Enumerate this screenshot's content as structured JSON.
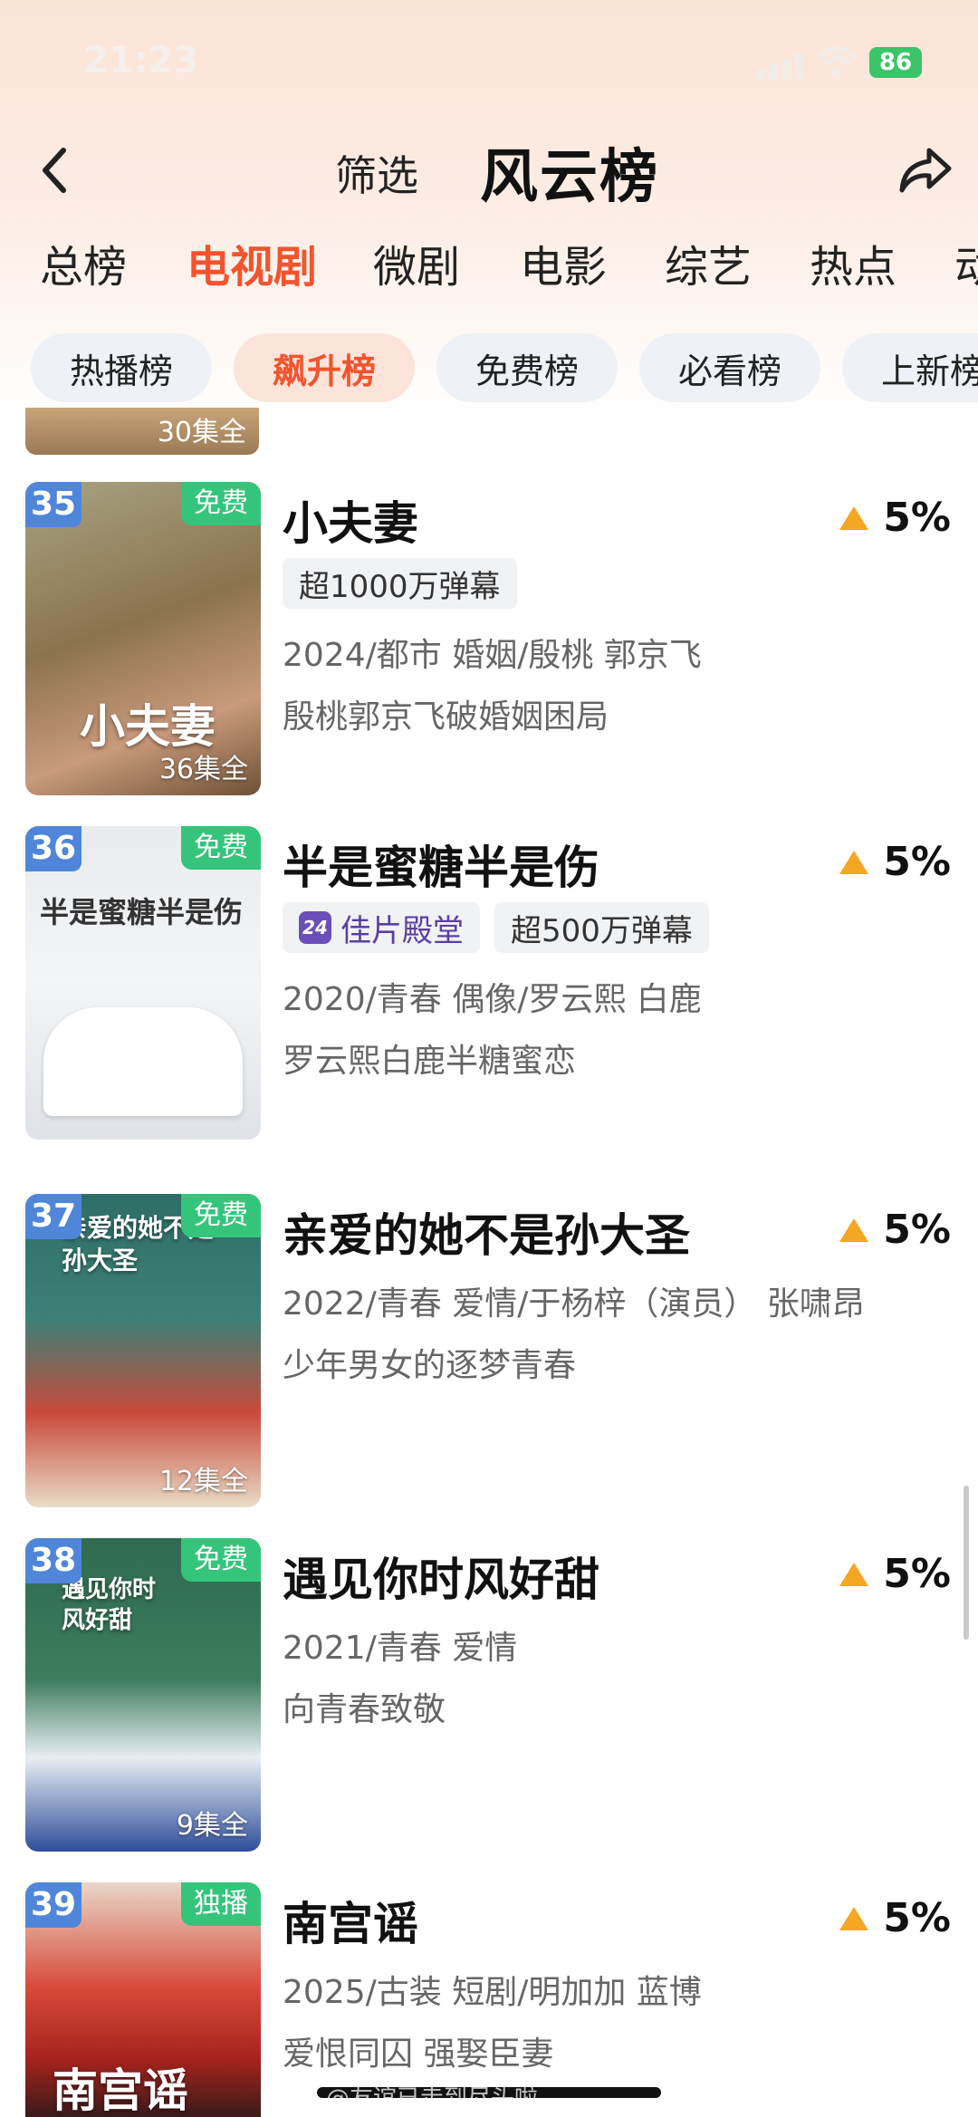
{
  "status_bar": {
    "time": "21:23",
    "battery": "86"
  },
  "header": {
    "back_icon": "chevron-left-icon",
    "filter_label": "筛选",
    "title": "风云榜",
    "share_icon": "share-icon"
  },
  "category_tabs": [
    "总榜",
    "电视剧",
    "微剧",
    "电影",
    "综艺",
    "热点",
    "动"
  ],
  "category_active": "电视剧",
  "sub_tabs": [
    "热播榜",
    "飙升榜",
    "免费榜",
    "必看榜",
    "上新榜"
  ],
  "sub_active": "飙升榜",
  "previous_item": {
    "episodes": "30集全"
  },
  "items": [
    {
      "rank": "35",
      "tag": "免费",
      "episodes": "36集全",
      "poster_text": "小夫妻",
      "title": "小夫妻",
      "change": "5%",
      "badges": [
        "超1000万弹幕"
      ],
      "meta": "2024/都市 婚姻/殷桃 郭京飞",
      "desc": "殷桃郭京飞破婚姻困局"
    },
    {
      "rank": "36",
      "tag": "免费",
      "episodes": "",
      "poster_text": "半是蜜糖半是伤",
      "title": "半是蜜糖半是伤",
      "change": "5%",
      "premium_badge": "佳片殿堂",
      "badges": [
        "超500万弹幕"
      ],
      "meta": "2020/青春 偶像/罗云熙 白鹿",
      "desc": "罗云熙白鹿半糖蜜恋"
    },
    {
      "rank": "37",
      "tag": "免费",
      "episodes": "12集全",
      "poster_text": "亲爱的她不是孙大圣",
      "title": "亲爱的她不是孙大圣",
      "change": "5%",
      "meta": "2022/青春 爱情/于杨梓（演员） 张啸昂",
      "desc": "少年男女的逐梦青春"
    },
    {
      "rank": "38",
      "tag": "免费",
      "episodes": "9集全",
      "poster_text": "遇见你时风好甜",
      "title": "遇见你时风好甜",
      "change": "5%",
      "meta": "2021/青春 爱情",
      "desc": "向青春致敬"
    },
    {
      "rank": "39",
      "tag": "独播",
      "episodes": "",
      "poster_text": "南宫谣",
      "title": "南宫谣",
      "change": "5%",
      "meta": "2025/古装 短剧/明加加 蓝博",
      "desc": "爱恨同囚 强娶臣妻"
    }
  ],
  "watermark": "@友谊已走到尽头啦",
  "colors": {
    "accent": "#f2542d",
    "rank_bg": "#4f86d9",
    "free_tag": "#34c57a",
    "trend_up": "#f5a623"
  }
}
